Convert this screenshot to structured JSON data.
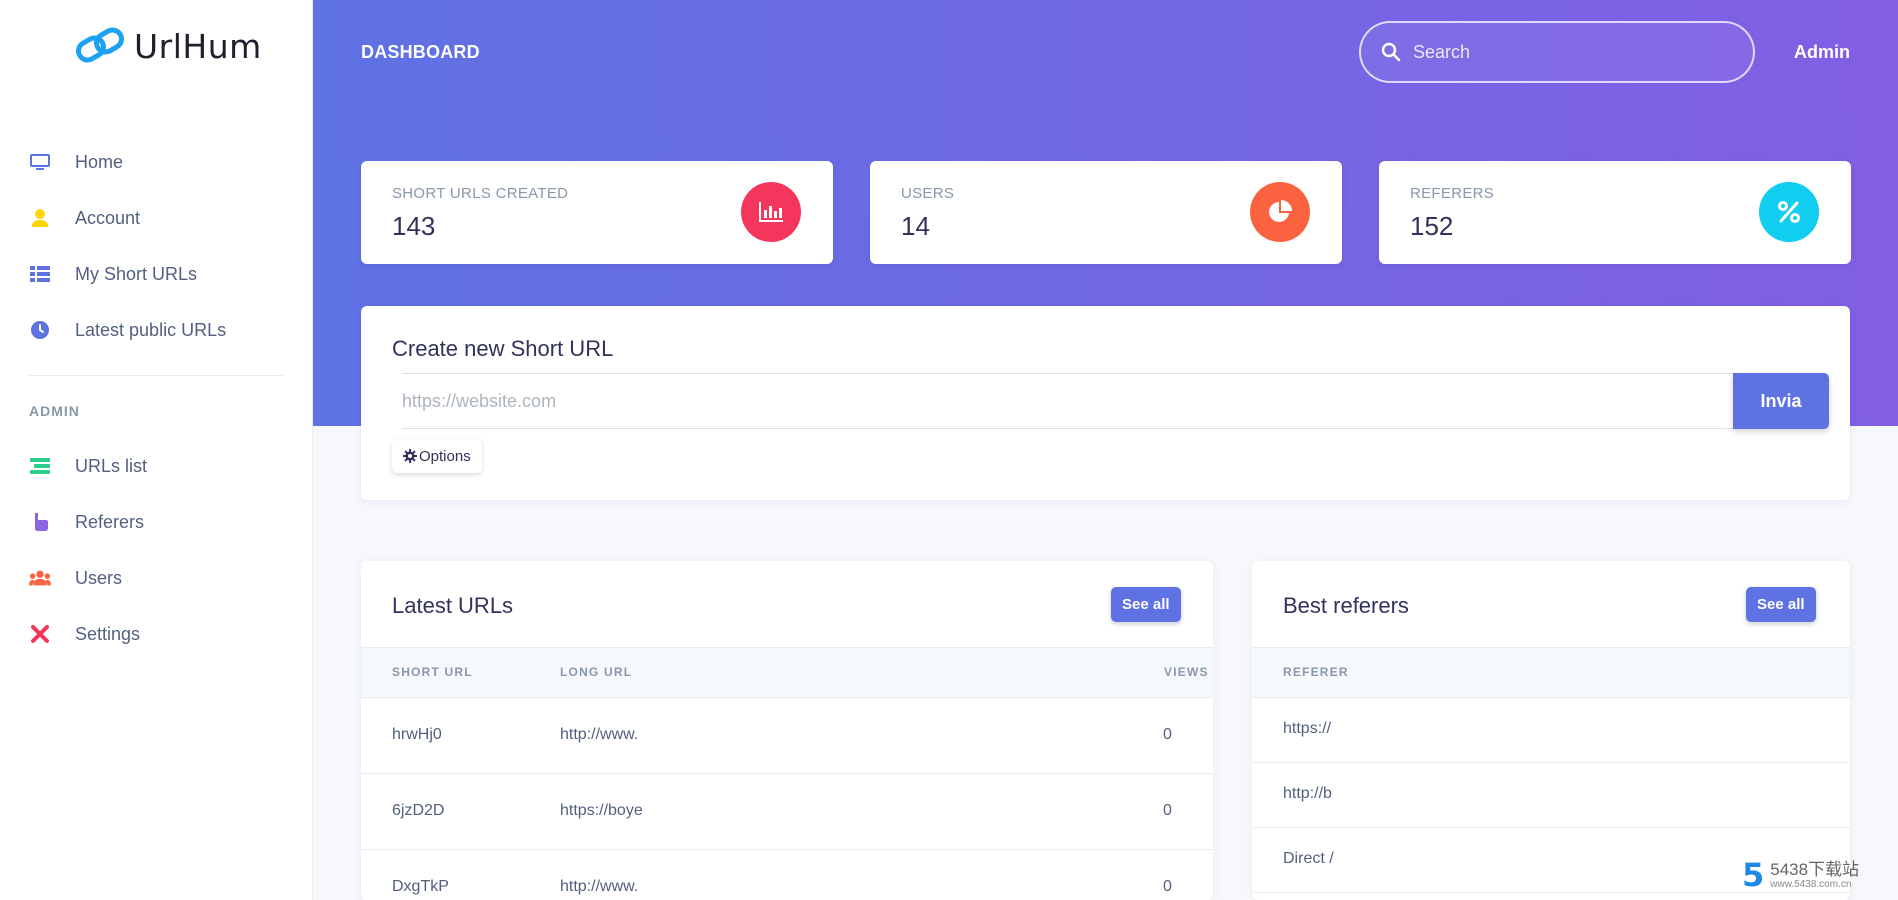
{
  "brand": {
    "name": "UrlHum"
  },
  "sidebar": {
    "items": [
      {
        "label": "Home",
        "icon": "monitor-icon",
        "color": "#5e72e4"
      },
      {
        "label": "Account",
        "icon": "user-icon",
        "color": "#ffd600"
      },
      {
        "label": "My Short URLs",
        "icon": "list-icon",
        "color": "#5e72e4"
      },
      {
        "label": "Latest public URLs",
        "icon": "clock-icon",
        "color": "#5e72e4"
      }
    ],
    "admin_heading": "ADMIN",
    "admin_items": [
      {
        "label": "URLs list",
        "icon": "align-icon",
        "color": "#2dce89"
      },
      {
        "label": "Referers",
        "icon": "pointer-icon",
        "color": "#8965e0"
      },
      {
        "label": "Users",
        "icon": "users-icon",
        "color": "#fb6340"
      },
      {
        "label": "Settings",
        "icon": "tools-icon",
        "color": "#f5365c"
      }
    ]
  },
  "header": {
    "title": "DASHBOARD",
    "search_placeholder": "Search",
    "user": "Admin"
  },
  "stats": [
    {
      "label": "SHORT URLS CREATED",
      "value": "143",
      "icon": "chart-bar-icon",
      "color": "#f5365c"
    },
    {
      "label": "USERS",
      "value": "14",
      "icon": "chart-pie-icon",
      "color": "#fb6340"
    },
    {
      "label": "REFERERS",
      "value": "152",
      "icon": "percent-icon",
      "color": "#11cdef"
    }
  ],
  "create": {
    "title": "Create new Short URL",
    "placeholder": "https://website.com",
    "submit": "Invia",
    "options": "Options"
  },
  "latest": {
    "title": "Latest URLs",
    "see_all": "See all",
    "columns": [
      "SHORT URL",
      "LONG URL",
      "VIEWS"
    ],
    "rows": [
      {
        "short": "hrwHj0",
        "long": "http://www.",
        "views": "0"
      },
      {
        "short": "6jzD2D",
        "long": "https://boye",
        "views": "0"
      },
      {
        "short": "DxgTkP",
        "long": "http://www.",
        "views": "0"
      }
    ]
  },
  "referers": {
    "title": "Best referers",
    "see_all": "See all",
    "columns": [
      "REFERER"
    ],
    "rows": [
      {
        "name": "https://"
      },
      {
        "name": "http://b"
      },
      {
        "name": "Direct / "
      }
    ]
  },
  "watermark": {
    "number": "5",
    "top": "5438下载站",
    "bottom": "www.5438.com.cn"
  },
  "colors": {
    "primary": "#5e72e4",
    "gradient_end": "#825ee4"
  }
}
